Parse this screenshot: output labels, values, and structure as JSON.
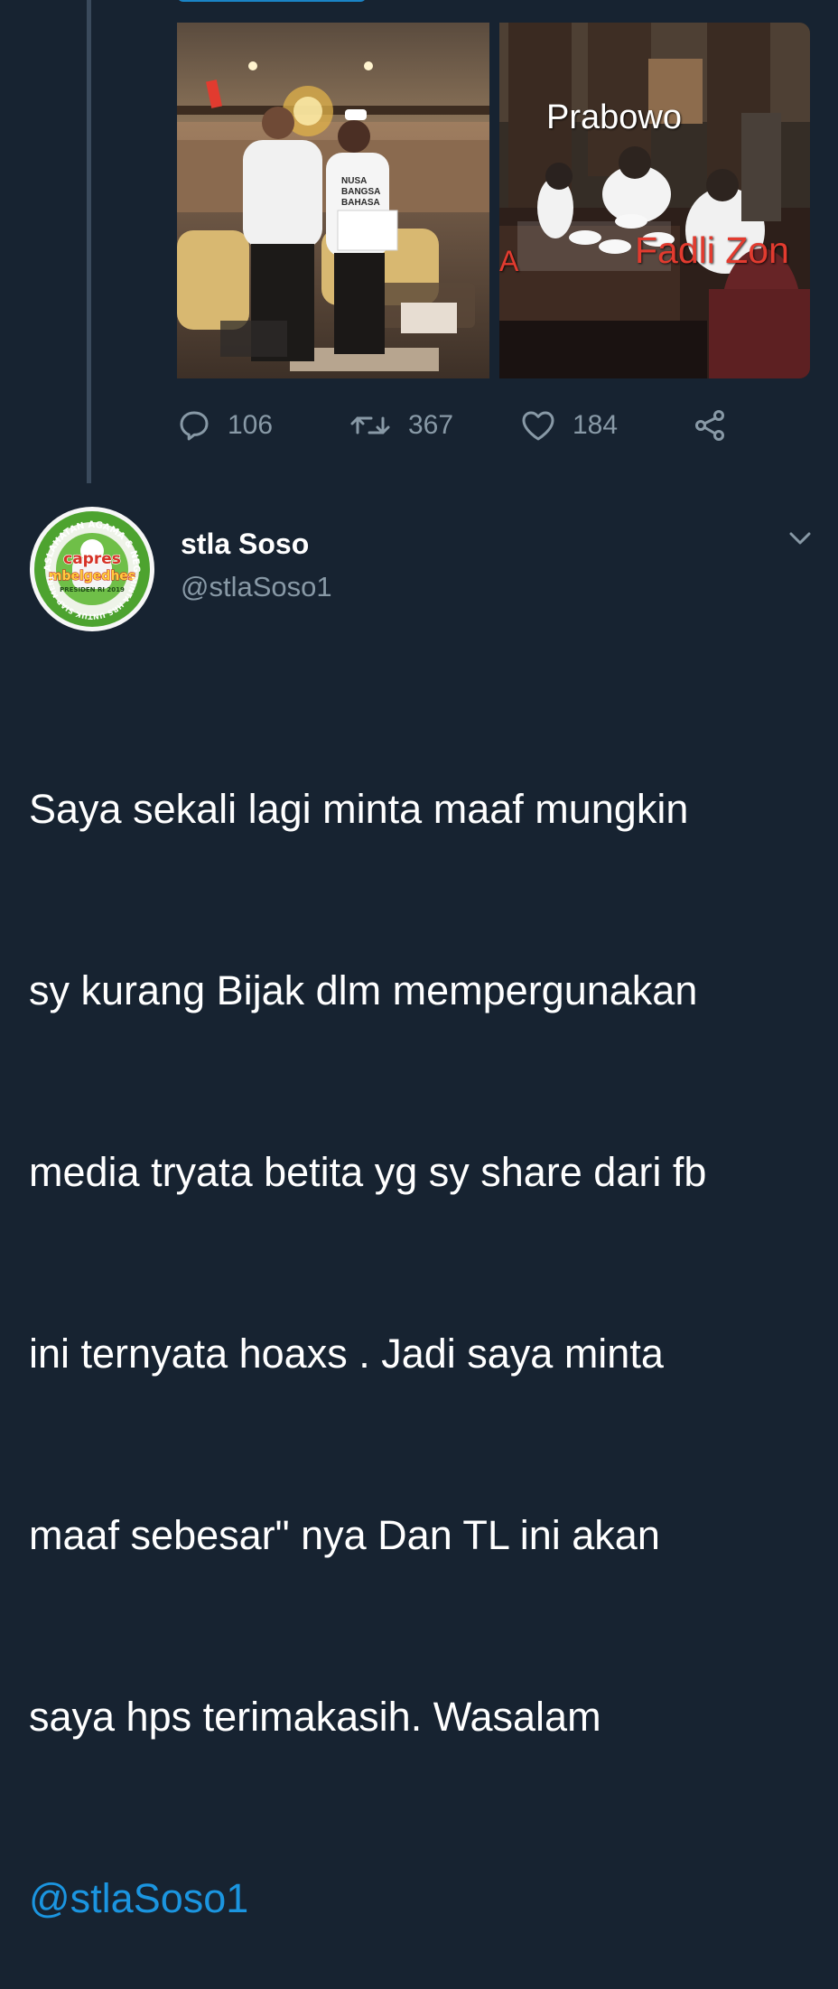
{
  "photos": {
    "left": {
      "shirt_text": "NUSA BANGSA BAHASA",
      "name": "photo-left"
    },
    "right": {
      "labels": {
        "prabowo": "Prabowo",
        "fadli": "Fadli Zon",
        "edge": "A"
      }
    }
  },
  "actions": {
    "reply_count": "106",
    "retweet_count": "367",
    "like_count": "184"
  },
  "author": {
    "name": "stla Soso",
    "handle": "@stlaSoso1",
    "avatar_text": {
      "top": "KEMASLAHATAN AGAMA & NEGARA",
      "line1": "capres",
      "line2": "mbelgedhes",
      "line3": "PRESIDEN RI 2019",
      "bottom": "MINTA HRS UNTUK SIAP MENJ"
    }
  },
  "tweet": {
    "lines": [
      "Saya sekali lagi minta maaf mungkin",
      "sy kurang Bijak dlm mempergunakan",
      "media tryata betita yg sy share dari fb",
      "ini ternyata hoaxs . Jadi saya minta",
      "maaf sebesar\" nya Dan TL ini akan",
      "saya  hps terimakasih. Wasalam"
    ],
    "mention": "@stlaSoso1"
  },
  "colors": {
    "background": "#172331",
    "accent": "#1b95e0",
    "muted": "#8899a6"
  },
  "icons": {
    "reply": "reply-icon",
    "retweet": "retweet-icon",
    "like": "heart-icon",
    "share": "share-icon",
    "menu": "chevron-down-icon"
  }
}
